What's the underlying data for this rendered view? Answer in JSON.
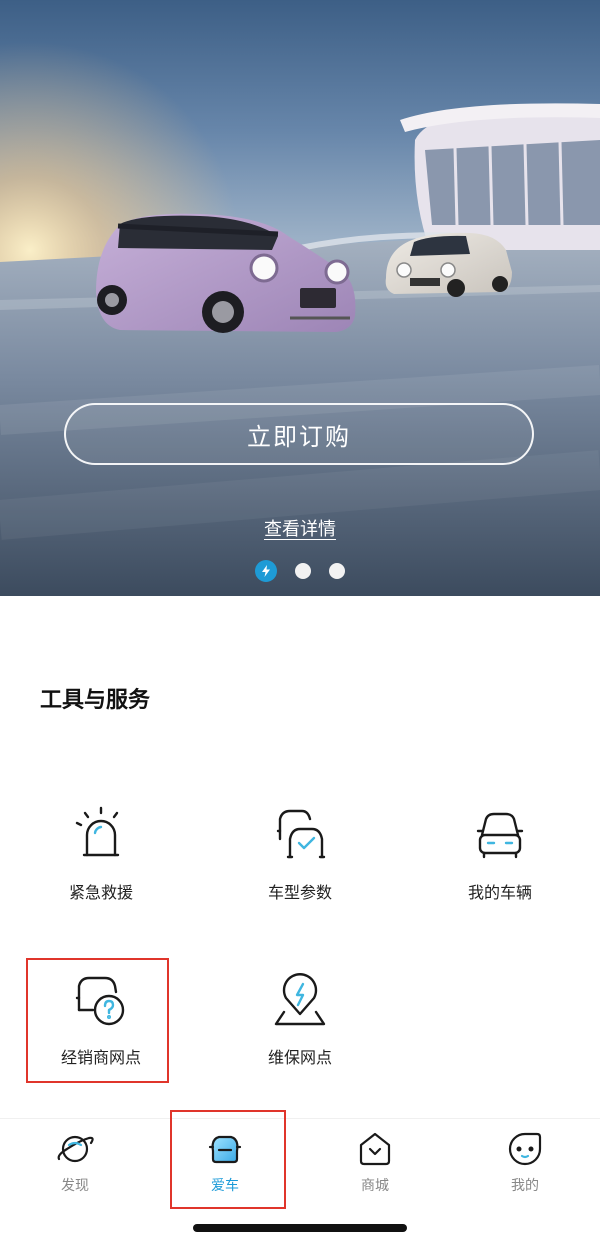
{
  "hero": {
    "cta_label": "立即订购",
    "details_link": "查看详情",
    "carousel": {
      "count": 3,
      "active_index": 0
    }
  },
  "tools": {
    "title": "工具与服务",
    "items": [
      {
        "label": "紧急救援",
        "icon": "emergency-light-icon"
      },
      {
        "label": "车型参数",
        "icon": "car-models-check-icon"
      },
      {
        "label": "我的车辆",
        "icon": "car-front-icon"
      },
      {
        "label": "经销商网点",
        "icon": "dealer-question-icon"
      },
      {
        "label": "维保网点",
        "icon": "service-location-icon"
      }
    ]
  },
  "tabbar": {
    "tabs": [
      {
        "label": "发现",
        "icon": "planet-icon"
      },
      {
        "label": "爱车",
        "icon": "car-icon",
        "active": true
      },
      {
        "label": "商城",
        "icon": "shop-heart-icon"
      },
      {
        "label": "我的",
        "icon": "face-icon"
      }
    ]
  },
  "colors": {
    "accent": "#1a9ad8",
    "highlight": "#e0352b"
  }
}
